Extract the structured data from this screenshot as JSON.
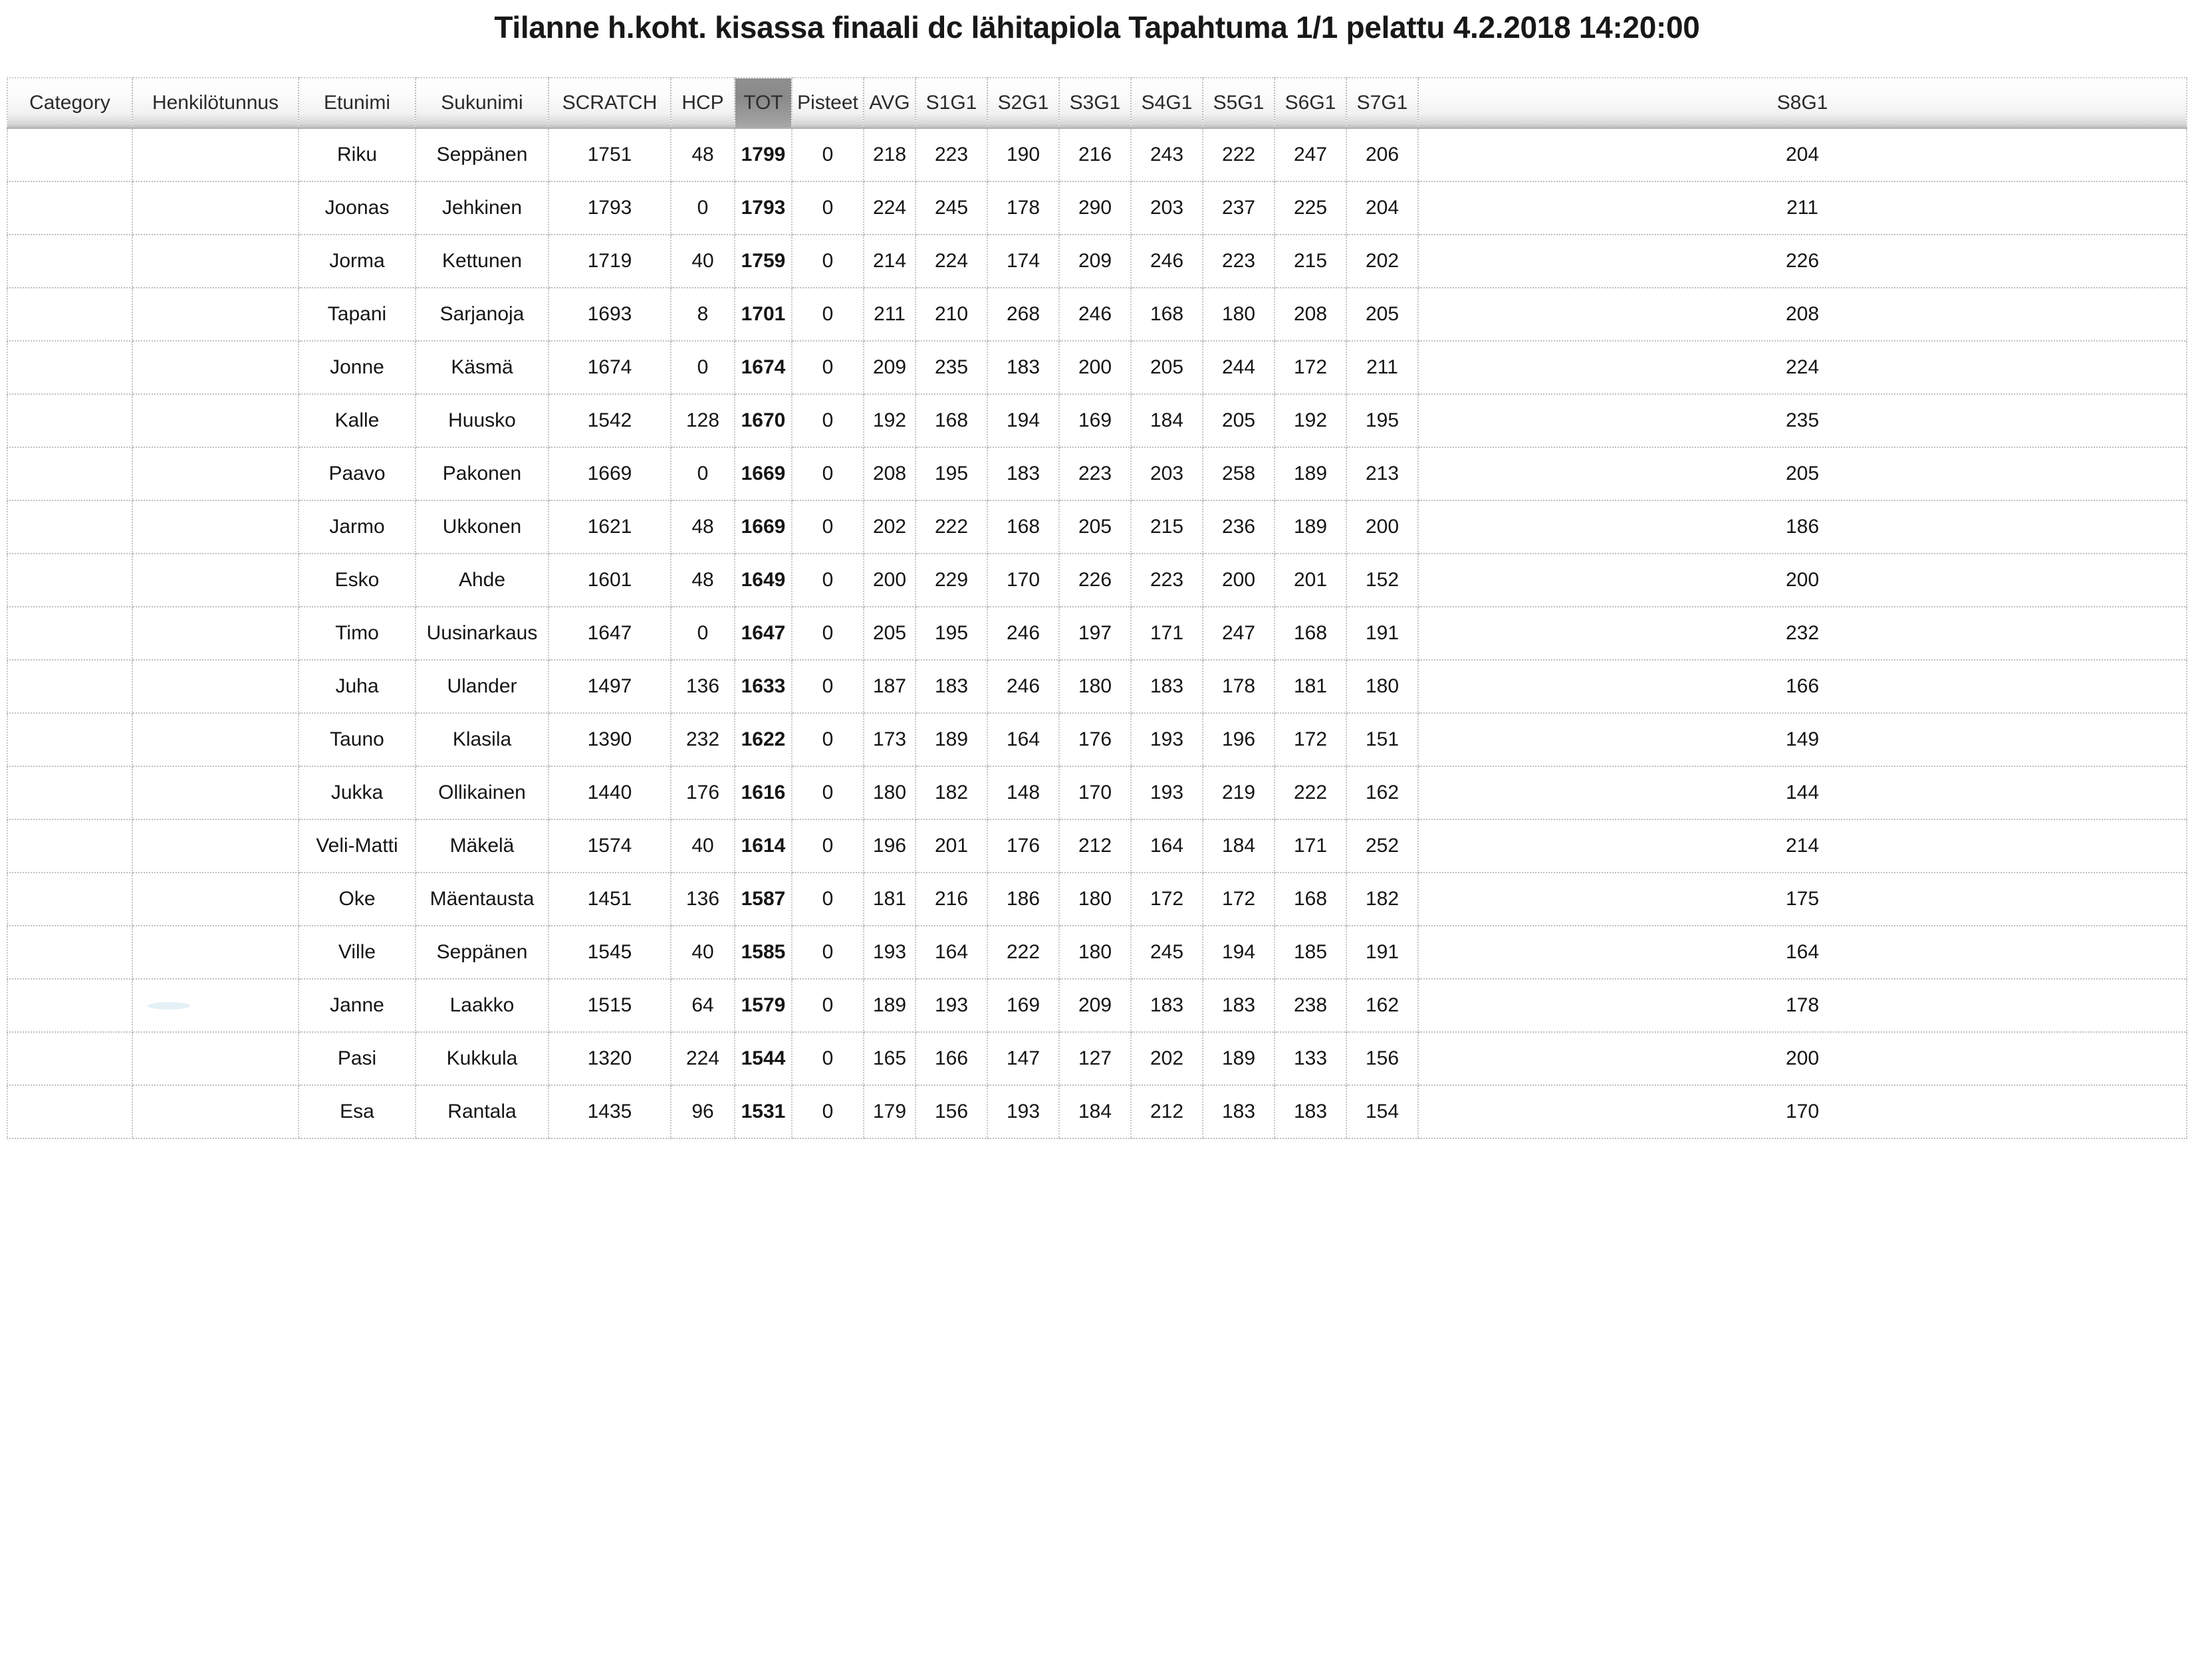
{
  "document": {
    "title": "Tilanne h.koht. kisassa finaali dc lähitapiola Tapahtuma 1/1 pelattu 4.2.2018 14:20:00"
  },
  "table": {
    "sorted_column": "TOT",
    "columns": [
      "Category",
      "Henkilötunnus",
      "Etunimi",
      "Sukunimi",
      "SCRATCH",
      "HCP",
      "TOT",
      "Pisteet",
      "AVG",
      "S1G1",
      "S2G1",
      "S3G1",
      "S4G1",
      "S5G1",
      "S6G1",
      "S7G1",
      "S8G1"
    ],
    "rows": [
      [
        "",
        "",
        "Riku",
        "Seppänen",
        "1751",
        "48",
        "1799",
        "0",
        "218",
        "223",
        "190",
        "216",
        "243",
        "222",
        "247",
        "206",
        "204"
      ],
      [
        "",
        "",
        "Joonas",
        "Jehkinen",
        "1793",
        "0",
        "1793",
        "0",
        "224",
        "245",
        "178",
        "290",
        "203",
        "237",
        "225",
        "204",
        "211"
      ],
      [
        "",
        "",
        "Jorma",
        "Kettunen",
        "1719",
        "40",
        "1759",
        "0",
        "214",
        "224",
        "174",
        "209",
        "246",
        "223",
        "215",
        "202",
        "226"
      ],
      [
        "",
        "",
        "Tapani",
        "Sarjanoja",
        "1693",
        "8",
        "1701",
        "0",
        "211",
        "210",
        "268",
        "246",
        "168",
        "180",
        "208",
        "205",
        "208"
      ],
      [
        "",
        "",
        "Jonne",
        "Käsmä",
        "1674",
        "0",
        "1674",
        "0",
        "209",
        "235",
        "183",
        "200",
        "205",
        "244",
        "172",
        "211",
        "224"
      ],
      [
        "",
        "",
        "Kalle",
        "Huusko",
        "1542",
        "128",
        "1670",
        "0",
        "192",
        "168",
        "194",
        "169",
        "184",
        "205",
        "192",
        "195",
        "235"
      ],
      [
        "",
        "",
        "Paavo",
        "Pakonen",
        "1669",
        "0",
        "1669",
        "0",
        "208",
        "195",
        "183",
        "223",
        "203",
        "258",
        "189",
        "213",
        "205"
      ],
      [
        "",
        "",
        "Jarmo",
        "Ukkonen",
        "1621",
        "48",
        "1669",
        "0",
        "202",
        "222",
        "168",
        "205",
        "215",
        "236",
        "189",
        "200",
        "186"
      ],
      [
        "",
        "",
        "Esko",
        "Ahde",
        "1601",
        "48",
        "1649",
        "0",
        "200",
        "229",
        "170",
        "226",
        "223",
        "200",
        "201",
        "152",
        "200"
      ],
      [
        "",
        "",
        "Timo",
        "Uusinarkaus",
        "1647",
        "0",
        "1647",
        "0",
        "205",
        "195",
        "246",
        "197",
        "171",
        "247",
        "168",
        "191",
        "232"
      ],
      [
        "",
        "",
        "Juha",
        "Ulander",
        "1497",
        "136",
        "1633",
        "0",
        "187",
        "183",
        "246",
        "180",
        "183",
        "178",
        "181",
        "180",
        "166"
      ],
      [
        "",
        "",
        "Tauno",
        "Klasila",
        "1390",
        "232",
        "1622",
        "0",
        "173",
        "189",
        "164",
        "176",
        "193",
        "196",
        "172",
        "151",
        "149"
      ],
      [
        "",
        "",
        "Jukka",
        "Ollikainen",
        "1440",
        "176",
        "1616",
        "0",
        "180",
        "182",
        "148",
        "170",
        "193",
        "219",
        "222",
        "162",
        "144"
      ],
      [
        "",
        "",
        "Veli-Matti",
        "Mäkelä",
        "1574",
        "40",
        "1614",
        "0",
        "196",
        "201",
        "176",
        "212",
        "164",
        "184",
        "171",
        "252",
        "214"
      ],
      [
        "",
        "",
        "Oke",
        "Mäentausta",
        "1451",
        "136",
        "1587",
        "0",
        "181",
        "216",
        "186",
        "180",
        "172",
        "172",
        "168",
        "182",
        "175"
      ],
      [
        "",
        "",
        "Ville",
        "Seppänen",
        "1545",
        "40",
        "1585",
        "0",
        "193",
        "164",
        "222",
        "180",
        "245",
        "194",
        "185",
        "191",
        "164"
      ],
      [
        "",
        "",
        "Janne",
        "Laakko",
        "1515",
        "64",
        "1579",
        "0",
        "189",
        "193",
        "169",
        "209",
        "183",
        "183",
        "238",
        "162",
        "178"
      ],
      [
        "",
        "",
        "Pasi",
        "Kukkula",
        "1320",
        "224",
        "1544",
        "0",
        "165",
        "166",
        "147",
        "127",
        "202",
        "189",
        "133",
        "156",
        "200"
      ],
      [
        "",
        "",
        "Esa",
        "Rantala",
        "1435",
        "96",
        "1531",
        "0",
        "179",
        "156",
        "193",
        "184",
        "212",
        "183",
        "183",
        "154",
        "170"
      ]
    ]
  },
  "colors": {
    "header_gradient_top": "#ffffff",
    "header_gradient_bottom": "#bdbdbd",
    "sorted_header_bg": "#8f8f8f",
    "grid_line": "#c6c6c6",
    "text": "#151515"
  }
}
